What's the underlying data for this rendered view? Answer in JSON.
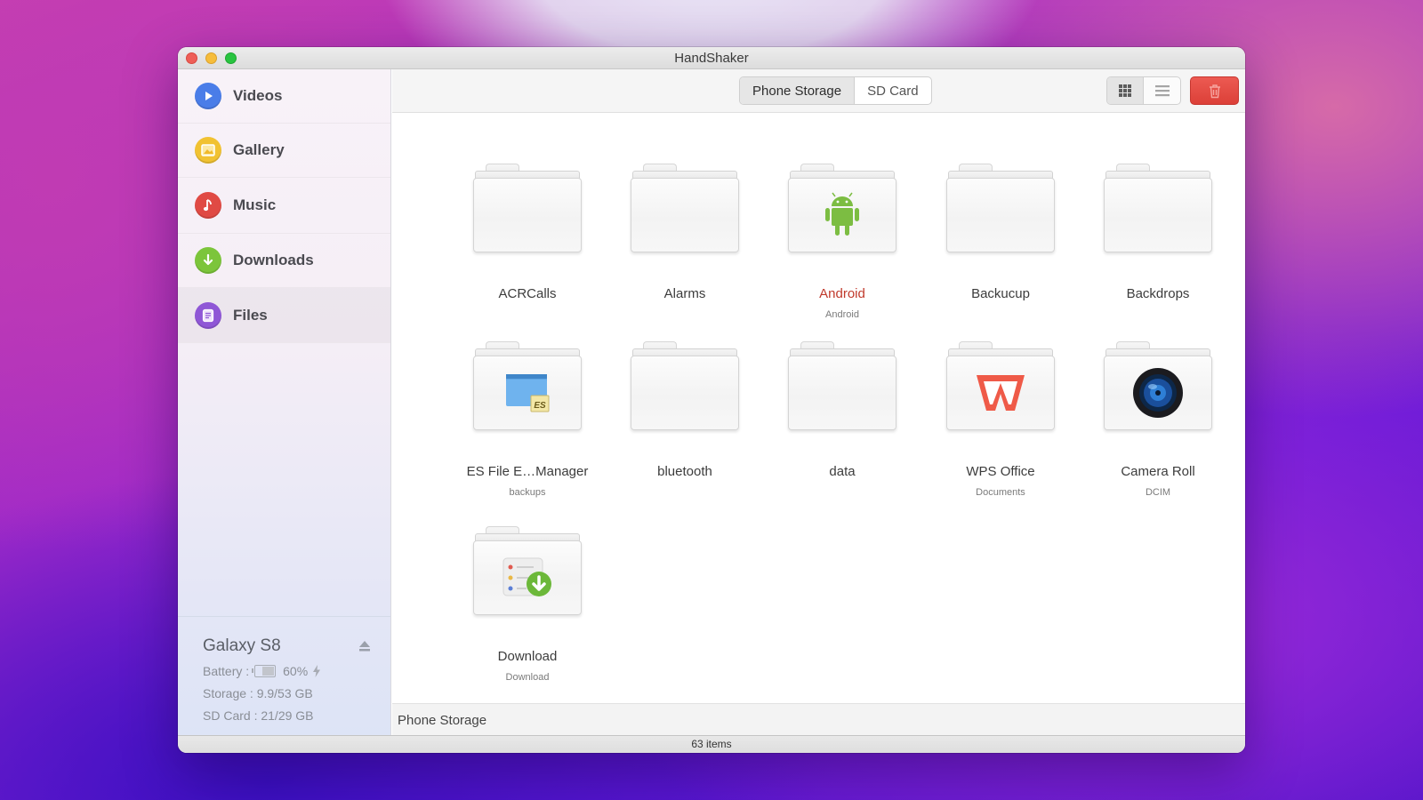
{
  "window": {
    "title": "HandShaker"
  },
  "sidebar": {
    "items": [
      {
        "label": "Videos",
        "icon": "play-icon",
        "color": "#4a7de8"
      },
      {
        "label": "Gallery",
        "icon": "image-icon",
        "color": "#f1c232"
      },
      {
        "label": "Music",
        "icon": "music-note-icon",
        "color": "#e04a44"
      },
      {
        "label": "Downloads",
        "icon": "download-arrow-icon",
        "color": "#7cc53b"
      },
      {
        "label": "Files",
        "icon": "document-icon",
        "color": "#8f57d6"
      }
    ],
    "active": "Files",
    "device": {
      "name": "Galaxy S8",
      "battery_label": "Battery :",
      "battery_percent": "60%",
      "battery_level": 0.6,
      "charging": true,
      "storage": "Storage : 9.9/53 GB",
      "sd_card": "SD Card : 21/29 GB"
    }
  },
  "toolbar": {
    "segments": [
      "Phone Storage",
      "SD Card"
    ],
    "selected_segment": "Phone Storage",
    "view_modes": [
      "grid-view",
      "list-view"
    ],
    "selected_view": "grid-view",
    "delete_icon": "trash-icon",
    "accent_delete": "#e04a42"
  },
  "files": [
    {
      "name": "ACRCalls",
      "sub": "",
      "badge": ""
    },
    {
      "name": "Alarms",
      "sub": "",
      "badge": ""
    },
    {
      "name": "Android",
      "sub": "Android",
      "badge": "android-icon",
      "highlight": true
    },
    {
      "name": "Backucup",
      "sub": "",
      "badge": ""
    },
    {
      "name": "Backdrops",
      "sub": "",
      "badge": ""
    },
    {
      "name": "ES File E…Manager",
      "sub": "backups",
      "badge": "es-file-explorer-icon"
    },
    {
      "name": "bluetooth",
      "sub": "",
      "badge": ""
    },
    {
      "name": "data",
      "sub": "",
      "badge": ""
    },
    {
      "name": "WPS Office",
      "sub": "Documents",
      "badge": "wps-office-icon"
    },
    {
      "name": "Camera Roll",
      "sub": "DCIM",
      "badge": "camera-lens-icon"
    },
    {
      "name": "Download",
      "sub": "Download",
      "badge": "download-list-icon"
    }
  ],
  "path_bar": "Phone Storage",
  "status": {
    "item_count": "63 items"
  }
}
